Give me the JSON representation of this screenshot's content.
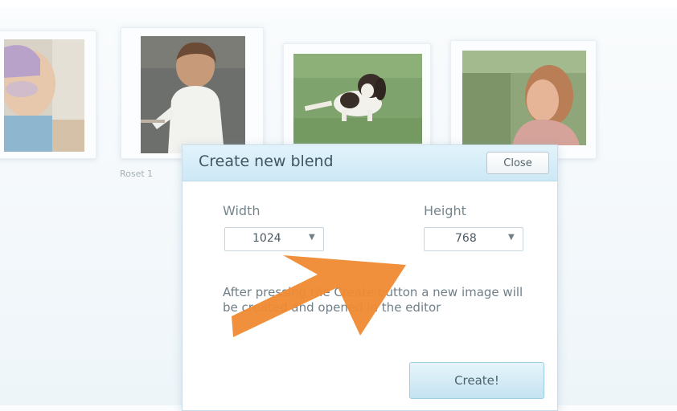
{
  "gallery": {
    "caption_2": "Roset 1"
  },
  "dialog": {
    "title": "Create new blend",
    "close_label": "Close",
    "width_label": "Width",
    "width_value": "1024",
    "height_label": "Height",
    "height_value": "768",
    "description": "After pressing the Create button a new image will be created and opened in the editor",
    "create_label": "Create!"
  },
  "overlay": {
    "arrow_color": "#f08a32"
  }
}
